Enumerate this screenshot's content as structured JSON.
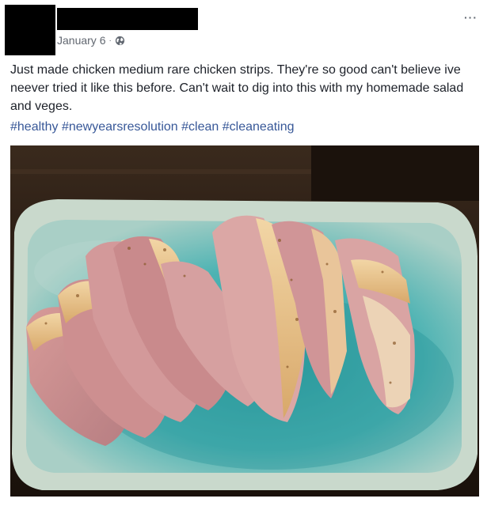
{
  "post": {
    "date": "January 6",
    "separator": "·",
    "privacy_icon": "globe-icon",
    "more_icon": "more-options-icon",
    "more_label": "···",
    "text": "Just made chicken medium rare chicken strips. They're so good can't believe ive neever tried it like this before. Can't wait to dig into this with my homemade salad and veges.",
    "hashtags": [
      "#healthy",
      "#newyearsresolution",
      "#clean",
      "#cleaneating"
    ],
    "photo_subject": "sliced seared chicken on teal plate"
  },
  "colors": {
    "link": "#385898",
    "meta": "#616770",
    "text": "#1d2129",
    "plate": "#59b7b4",
    "table": "#2a1d14"
  }
}
